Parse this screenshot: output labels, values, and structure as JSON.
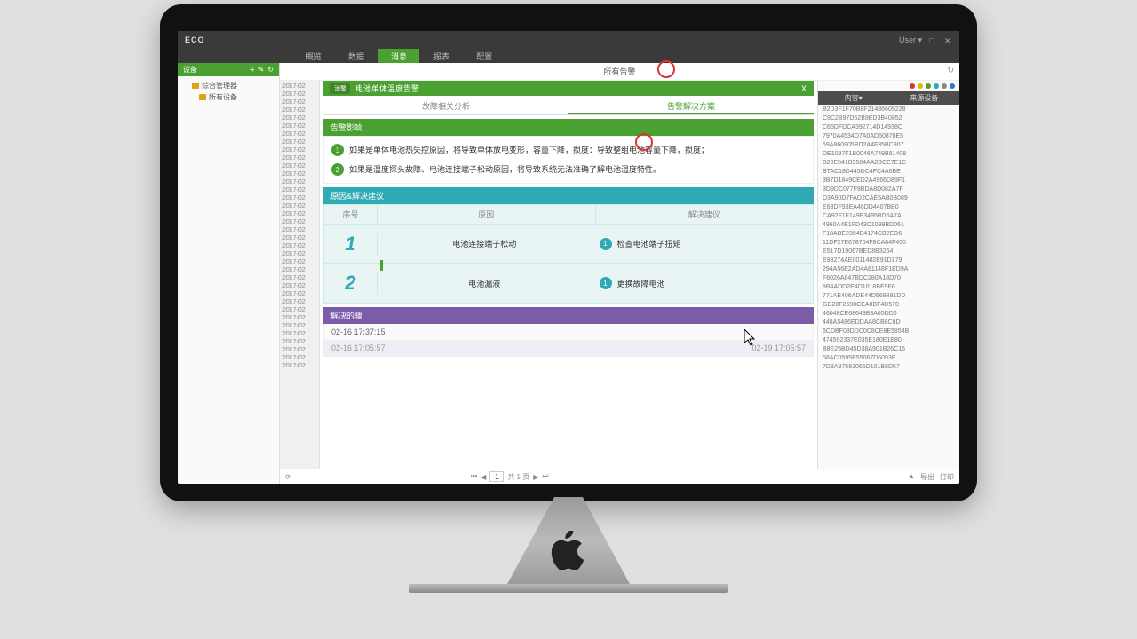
{
  "header": {
    "logo": "ECO",
    "user": "User ▾"
  },
  "nav": {
    "tabs": [
      "概览",
      "数据",
      "消息",
      "报表",
      "配置"
    ],
    "active_tab": "消息"
  },
  "sidebar": {
    "title": "设备",
    "items": [
      "综合管理器",
      "所有设备"
    ]
  },
  "main": {
    "title": "所有告警",
    "alert_banner": "电池单体温度告警",
    "tabs2": {
      "left": "故障相关分析",
      "right": "告警解决方案"
    },
    "impact_header": "告警影响",
    "impacts": [
      "如果是单体电池热失控原因，将导致单体放电变形，容量下降，损度：导致整组电池容量下降，损度；",
      "如果是温度探头故障、电池连接端子松动原因，将导致系统无法准确了解电池温度特性。"
    ],
    "cause_header": "原因&解决建议",
    "cause_cols": {
      "c1": "序号",
      "c2": "原因",
      "c3": "解决建议"
    },
    "causes": [
      {
        "n": "1",
        "reason": "电池连接端子松动",
        "solution": "检查电池端子扭矩"
      },
      {
        "n": "2",
        "reason": "电池漏液",
        "solution": "更换故障电池"
      }
    ],
    "steps_header": "解决的骤",
    "steps": [
      {
        "left": "02-16 17:37:15",
        "right": ""
      },
      {
        "left": "02-16 17:05:57",
        "right": "02-19 17:05:57"
      }
    ],
    "pager": {
      "page": "1",
      "total": "共 1 页"
    },
    "footer_right": [
      "▲",
      "导出",
      "打印"
    ]
  },
  "timeline_dates": [
    "2017-02",
    "2017-02",
    "2017-02",
    "2017-02",
    "2017-02",
    "2017-02",
    "2017-02",
    "2017-02",
    "2017-02",
    "2017-02",
    "2017-02",
    "2017-02",
    "2017-02",
    "2017-02",
    "2017-02",
    "2017-02",
    "2017-02",
    "2017-02",
    "2017-02",
    "2017-02",
    "2017-02",
    "2017-02",
    "2017-02",
    "2017-02",
    "2017-02",
    "2017-02",
    "2017-02",
    "2017-02",
    "2017-02",
    "2017-02",
    "2017-02",
    "2017-02",
    "2017-02",
    "2017-02",
    "2017-02",
    "2017-02"
  ],
  "right": {
    "legend_colors": [
      "#d33",
      "#e6b800",
      "#4aa030",
      "#2faab5",
      "#888",
      "#3377cc"
    ],
    "head": [
      "内容▾",
      "来源设备"
    ],
    "list": [
      "B2D3F1F70B8F21486609228",
      "C9C2B97D52B9ED3B40852",
      "C65DFDCA392714D14938C",
      "7970A4534D7A0AD50878E5",
      "59A860905BD2A4F85BC907",
      "DE1097F1B0046A749B81408",
      "B20E841B9584AA2BCE7E1C",
      "BTAC18D445DC4FC4A6BE",
      "3B7D1849CED2A4966D89F1",
      "3D9DC077F9BDA8D082A7F",
      "D3A90D7FAD2CAE5AB0B089",
      "E63DF93EA48DD4407BB0",
      "CA92F1F149E3495BD6A7A",
      "4960A4E1FD43C1099BD061",
      "F18ABE2304B4174CB2ED6",
      "11DF27E678704F8CA84F450",
      "E517D19067BED8B3264",
      "E98274AE0011482E91D179",
      "294A56E2AD4A81148F1ED9A",
      "F6026A847BDC280A18D70",
      "8B4ADD2E4D1018BE9F6",
      "771AE406ADE44D569881DD",
      "GD20F2598CEA8BF4D570",
      "46048CE68649B3A65DD6",
      "448A5486EDDAA8CB8C8D",
      "6CDBF03DDC0C8CE8E5854B",
      "474592337E035E180E1E80",
      "B8E25BD45D38A901B26C16",
      "58AC0595E55067D6093E",
      "7D3A97581065D101B8D57"
    ]
  }
}
